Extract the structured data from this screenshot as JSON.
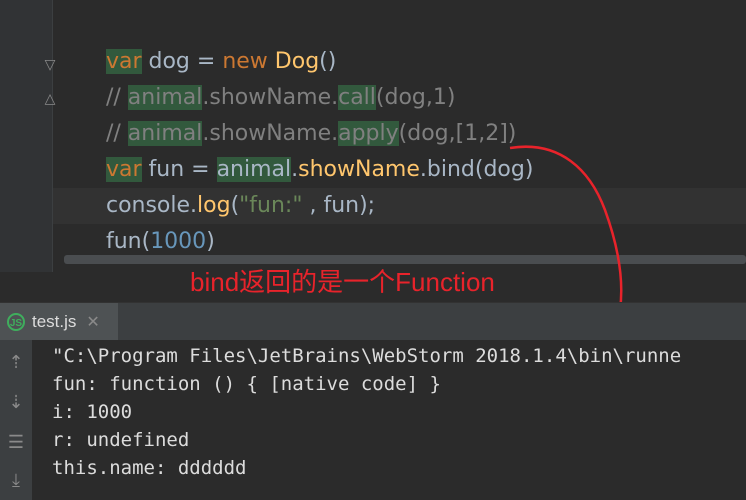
{
  "editor": {
    "lines": [
      {
        "kw": "var",
        "rest1": " dog = ",
        "kw2": "new",
        "fn": " Dog",
        "rest2": "()"
      },
      {
        "comment1": "// ",
        "m1": "animal",
        "rest": ".showName.",
        "m2": "call",
        "tail": "(dog,1)"
      },
      {
        "comment1": "// ",
        "m1": "animal",
        "rest": ".showName.",
        "m2": "apply",
        "tail": "(dog,[1,2])"
      },
      {
        "kw": "var",
        "rest1": " fun = ",
        "obj": "animal",
        "dot": ".",
        "fn": "showName",
        "rest2": ".bind(dog)"
      },
      {
        "a": "console.",
        "fn": "log",
        "p": "(",
        "str": "\"fun:\"",
        "sep": " , fun);"
      },
      {
        "a": "fun(",
        "num": "1000",
        "b": ")"
      }
    ]
  },
  "annotation": {
    "text": "bind返回的是一个Function",
    "color": "#e8232b"
  },
  "tab": {
    "label": "test.js",
    "icon": "js-file-icon",
    "close": "✕",
    "icon_text": "JS"
  },
  "console": {
    "lines": [
      "\"C:\\Program Files\\JetBrains\\WebStorm 2018.1.4\\bin\\runne",
      "fun: function () { [native code] }",
      "i: 1000",
      "r: undefined",
      "this.name: dddddd"
    ]
  },
  "tools": [
    "arrow-up-icon",
    "arrow-down-icon",
    "soft-wrap-icon",
    "scroll-to-end-icon"
  ],
  "colors": {
    "keyword": "#cc7832",
    "number": "#6897bb",
    "string": "#6a8759",
    "function": "#ffc66d",
    "comment": "#808080"
  }
}
